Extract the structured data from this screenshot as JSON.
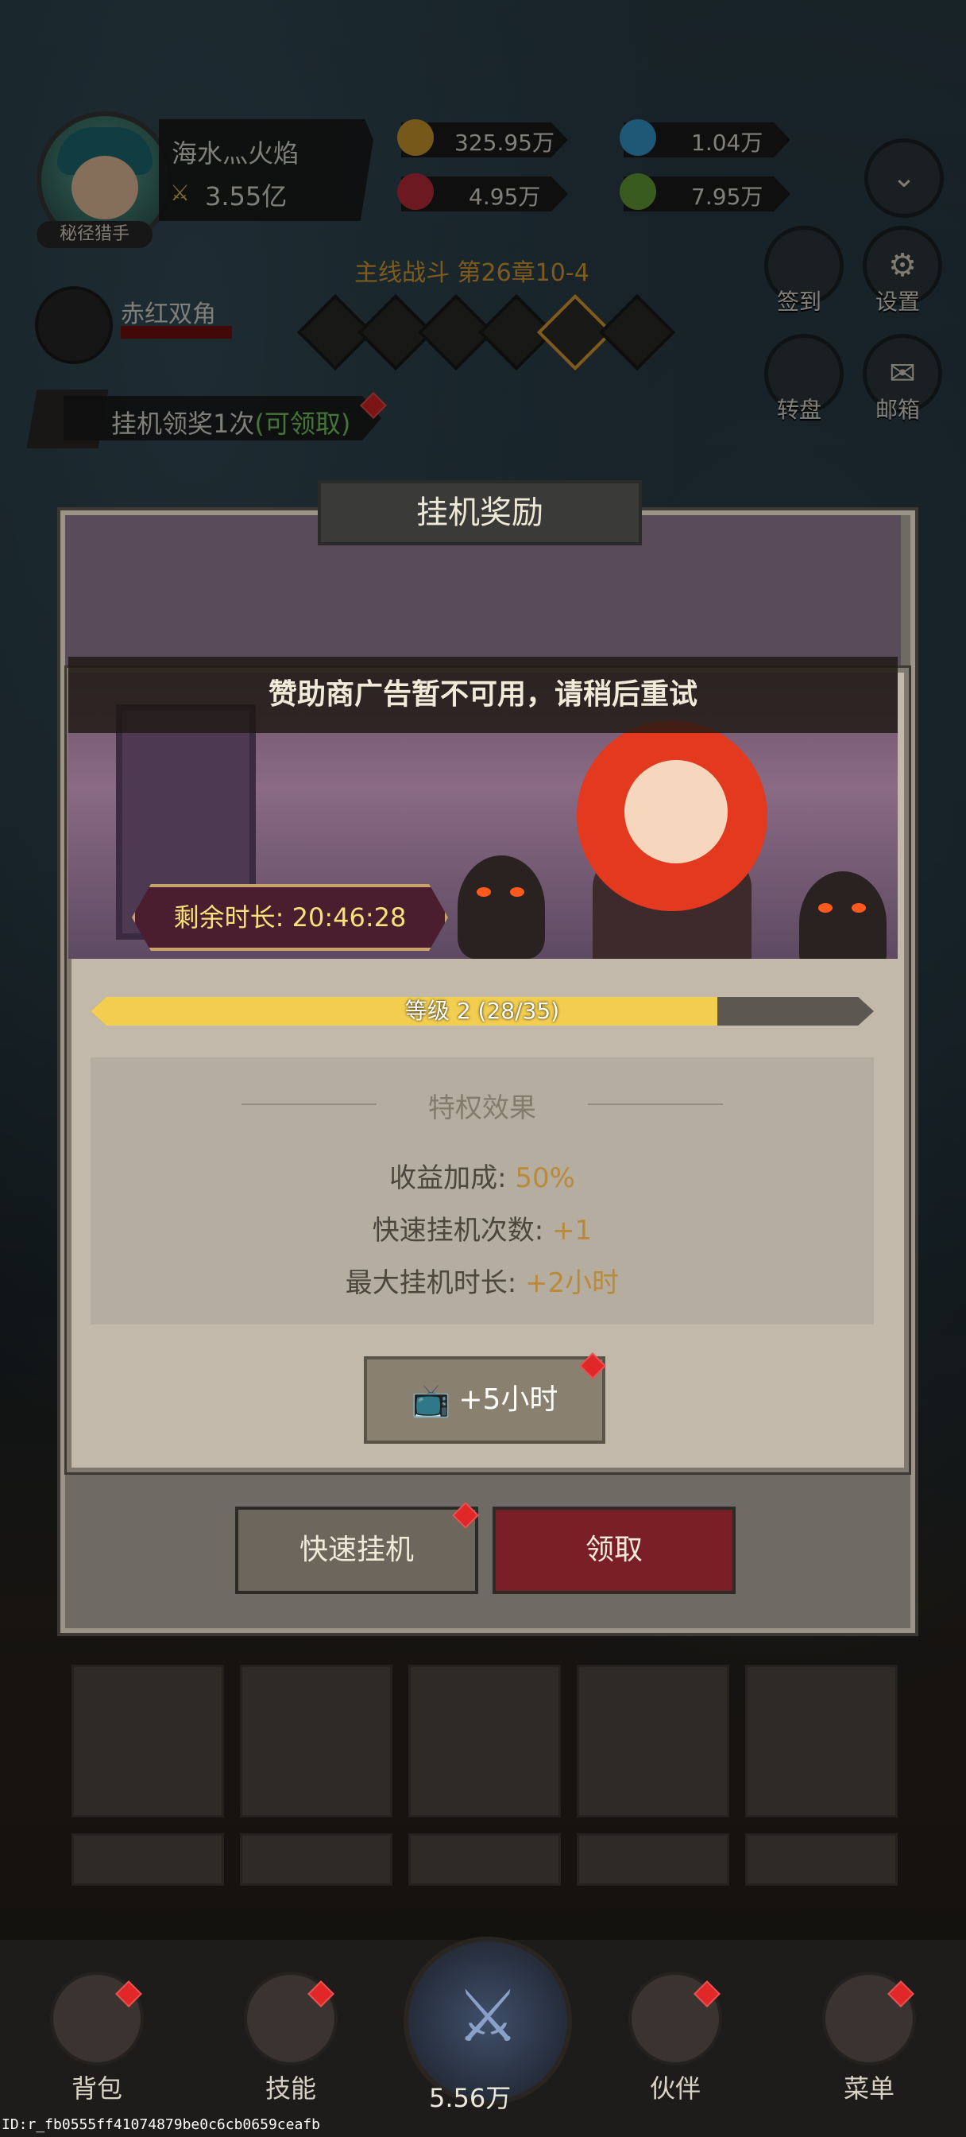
{
  "player": {
    "title_tag": "秘径猎手",
    "name": "海水灬火焰",
    "power": "3.55亿"
  },
  "resources": {
    "gold": "325.95万",
    "crystal": "1.04万",
    "gem": "4.95万",
    "ticket": "7.95万"
  },
  "side_menu": {
    "signin": "签到",
    "settings": "设置",
    "wheel": "转盘",
    "mail": "邮箱"
  },
  "stage": {
    "title": "主线战斗 第26章10-4"
  },
  "enemy": {
    "name": "赤红双角"
  },
  "idle_banner": {
    "text": "挂机领奖1次",
    "claim": "(可领取)"
  },
  "idle_dialog": {
    "title": "挂机奖励",
    "quick_label": "快速挂机",
    "claim_label": "领取"
  },
  "privilege_dialog": {
    "toast": "赞助商广告暂不可用，请稍后重试",
    "timer": "剩余时长: 20:46:28",
    "level_text": "等级 2 (28/35)",
    "level_progress": 0.8,
    "perk_title": "特权效果",
    "perks": [
      {
        "label": "收益加成: ",
        "value": "50%"
      },
      {
        "label": "快速挂机次数: ",
        "value": "+1"
      },
      {
        "label": "最大挂机时长: ",
        "value": "+2小时"
      }
    ],
    "ad_button": "+5小时"
  },
  "nav": {
    "bag": "背包",
    "skills": "技能",
    "battle_value": "5.56万",
    "partner": "伙伴",
    "menu": "菜单"
  },
  "footer_id": "ID:r_fb0555ff41074879be0c6cb0659ceafb",
  "colors": {
    "accent_gold": "#f2cd4f",
    "claim_green": "#7ed36a",
    "claim_red": "#7a1f26"
  }
}
